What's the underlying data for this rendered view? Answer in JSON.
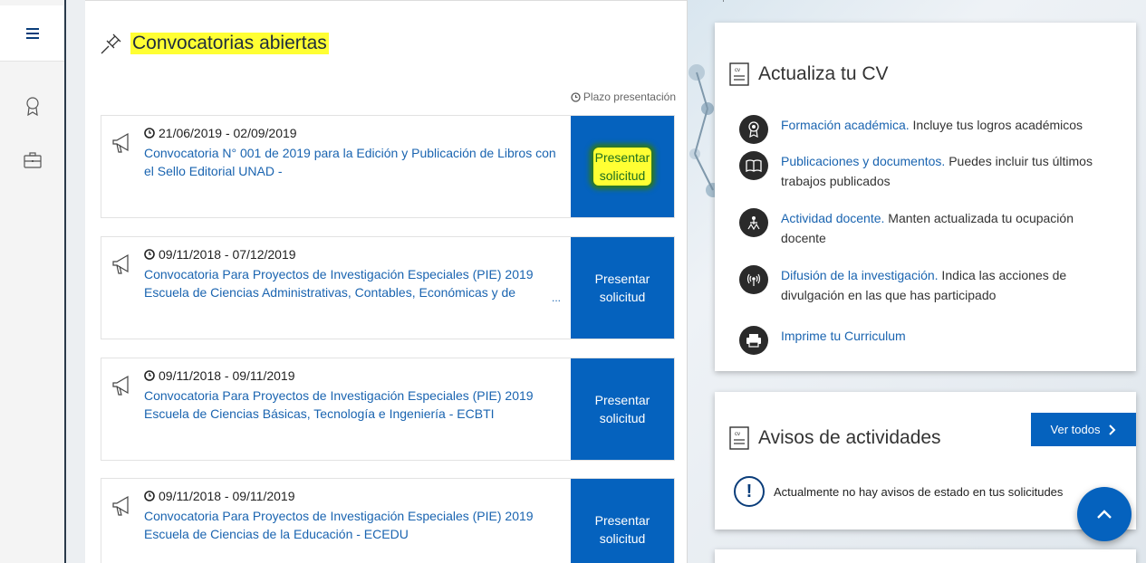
{
  "main": {
    "title": "Convocatorias abiertas",
    "plazo_label": "Plazo presentación",
    "convocatorias": [
      {
        "dates": "21/06/2019 - 02/09/2019",
        "title": "Convocatoria N° 001 de 2019 para la Edición y Publicación de Libros con el Sello Editorial UNAD -",
        "ellipsis": "",
        "button": "Presentar solicitud"
      },
      {
        "dates": "09/11/2018 - 07/12/2019",
        "title": "Convocatoria Para Proyectos de Investigación Especiales (PIE) 2019 Escuela de Ciencias Administrativas, Contables, Económicas y de",
        "ellipsis": "...",
        "button": "Presentar solicitud"
      },
      {
        "dates": "09/11/2018 - 09/11/2019",
        "title": "Convocatoria Para Proyectos de Investigación Especiales (PIE) 2019 Escuela de Ciencias Básicas, Tecnología e Ingeniería - ECBTI",
        "ellipsis": "",
        "button": "Presentar solicitud"
      },
      {
        "dates": "09/11/2018 - 09/11/2019",
        "title": "Convocatoria Para Proyectos de Investigación Especiales (PIE) 2019 Escuela de Ciencias de la Educación - ECEDU",
        "ellipsis": "",
        "button": "Presentar solicitud"
      }
    ]
  },
  "cv_card": {
    "title": "Actualiza tu CV",
    "items": [
      {
        "icon": "award-icon",
        "link": "Formación académica.",
        "text": " Incluye tus logros académicos"
      },
      {
        "icon": "book-icon",
        "link": "Publicaciones y documentos.",
        "text": " Puedes incluir tus últimos trabajos publicados"
      },
      {
        "icon": "teacher-icon",
        "link": "Actividad docente.",
        "text": " Manten actualizada tu ocupación docente"
      },
      {
        "icon": "broadcast-icon",
        "link": "Difusión de la investigación.",
        "text": " Indica las acciones de divulgación en las que has participado"
      },
      {
        "icon": "printer-icon",
        "link": "Imprime tu Curriculum",
        "text": ""
      }
    ]
  },
  "avisos_card": {
    "title": "Avisos de actividades",
    "ver_todos": "Ver todos",
    "message": "Actualmente no hay avisos de estado en tus solicitudes"
  },
  "colors": {
    "primary": "#0562be",
    "link": "#1a64b0",
    "highlight": "#ffff33"
  }
}
